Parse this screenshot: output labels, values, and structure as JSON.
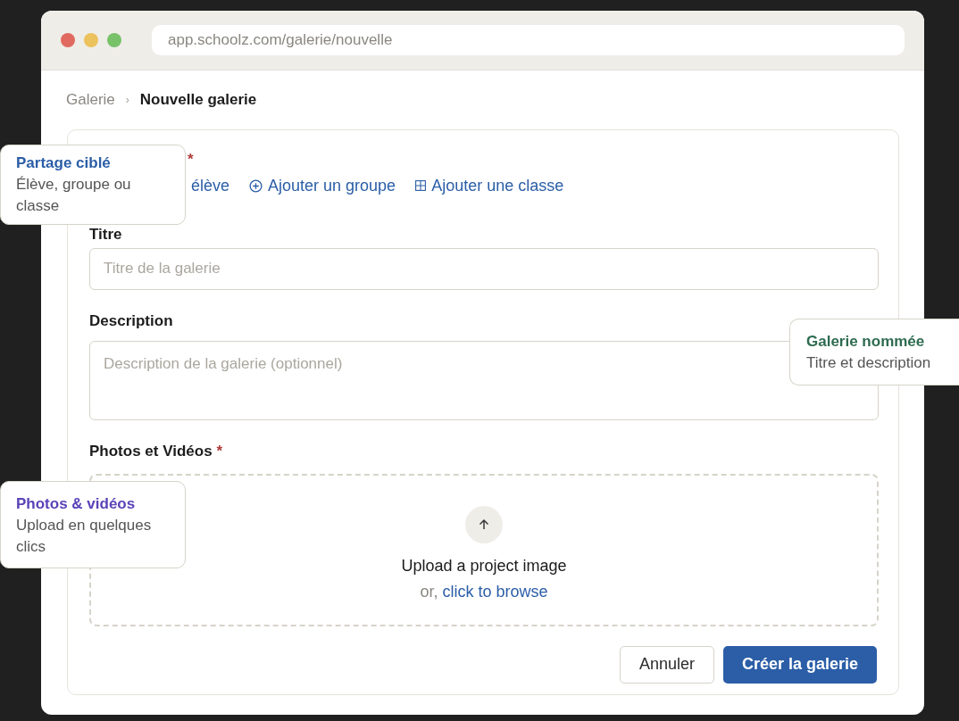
{
  "window": {
    "url": "app.schoolz.com/galerie/nouvelle"
  },
  "breadcrumb": {
    "separator": "›",
    "items": [
      {
        "label": "Galerie",
        "current": false
      },
      {
        "label": "Nouvelle galerie",
        "current": true
      }
    ]
  },
  "form": {
    "required_mark": "*",
    "share": {
      "required": true,
      "links": [
        {
          "label": "élève",
          "kind": "student"
        },
        {
          "label": "Ajouter un groupe",
          "kind": "group"
        },
        {
          "label": "Ajouter une classe",
          "kind": "class"
        }
      ]
    },
    "fields": [
      {
        "label": "Titre",
        "kind": "input",
        "placeholder": "Titre de la galerie",
        "required": false
      },
      {
        "label": "Description",
        "kind": "textarea",
        "placeholder": "Description de la galerie (optionnel)",
        "required": false
      }
    ],
    "upload": {
      "label": "Photos et Vidéos",
      "required": true,
      "prompt": "Upload a project image",
      "or": "or,",
      "browse": "click to browse"
    },
    "buttons": [
      {
        "label": "Annuler",
        "kind": "secondary"
      },
      {
        "label": "Créer la galerie",
        "kind": "primary"
      }
    ]
  },
  "callouts": [
    {
      "title": "Partage ciblé",
      "text": "Élève, groupe ou classe",
      "color": "#2b5ea7"
    },
    {
      "title": "Galerie nommée",
      "text": "Titre et description",
      "color": "#2e6b50"
    },
    {
      "title": "Photos & vidéos",
      "text": "Upload en quelques clics",
      "color": "#5a43b8"
    }
  ]
}
